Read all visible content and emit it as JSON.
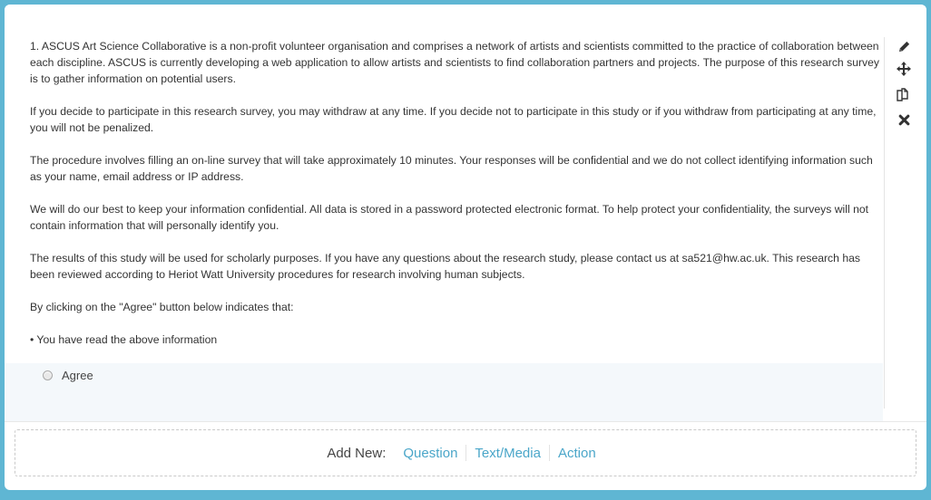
{
  "question": {
    "paragraphs": [
      "1. ASCUS Art Science Collaborative is a non-profit volunteer organisation and comprises a network of artists and scientists committed to the practice of collaboration between each discipline. ASCUS is currently developing a web application to allow artists and scientists to find collaboration partners and projects. The purpose of this research survey is to gather information on potential users.",
      "If you decide to participate in this research survey, you may withdraw at any time. If you decide not to participate in this study or if you withdraw from participating at any time, you will not be penalized.",
      "The procedure involves filling an on-line survey that will take approximately 10 minutes. Your responses will be confidential and we do not collect identifying information such as your name, email address or IP address.",
      "We will do our best to keep your information confidential. All data is stored in a password protected electronic format. To help protect your confidentiality, the surveys will not contain information that will personally identify you.",
      "The results of this study will be used for scholarly purposes. If you have any questions about the research study, please contact us at sa521@hw.ac.uk. This research has been reviewed according to Heriot Watt University procedures for research involving human subjects.",
      "By clicking on the \"Agree\" button below indicates that:",
      "• You have read the above information"
    ],
    "choices": [
      "Agree"
    ]
  },
  "toolbar": {
    "icons": [
      "pencil-icon",
      "move-icon",
      "copy-icon",
      "close-icon"
    ]
  },
  "add_new": {
    "label": "Add New:",
    "links": [
      "Question",
      "Text/Media",
      "Action"
    ]
  },
  "colors": {
    "background": "#5fb6d3",
    "link": "#4aa6c9",
    "answer_area": "#f4f8fb"
  }
}
